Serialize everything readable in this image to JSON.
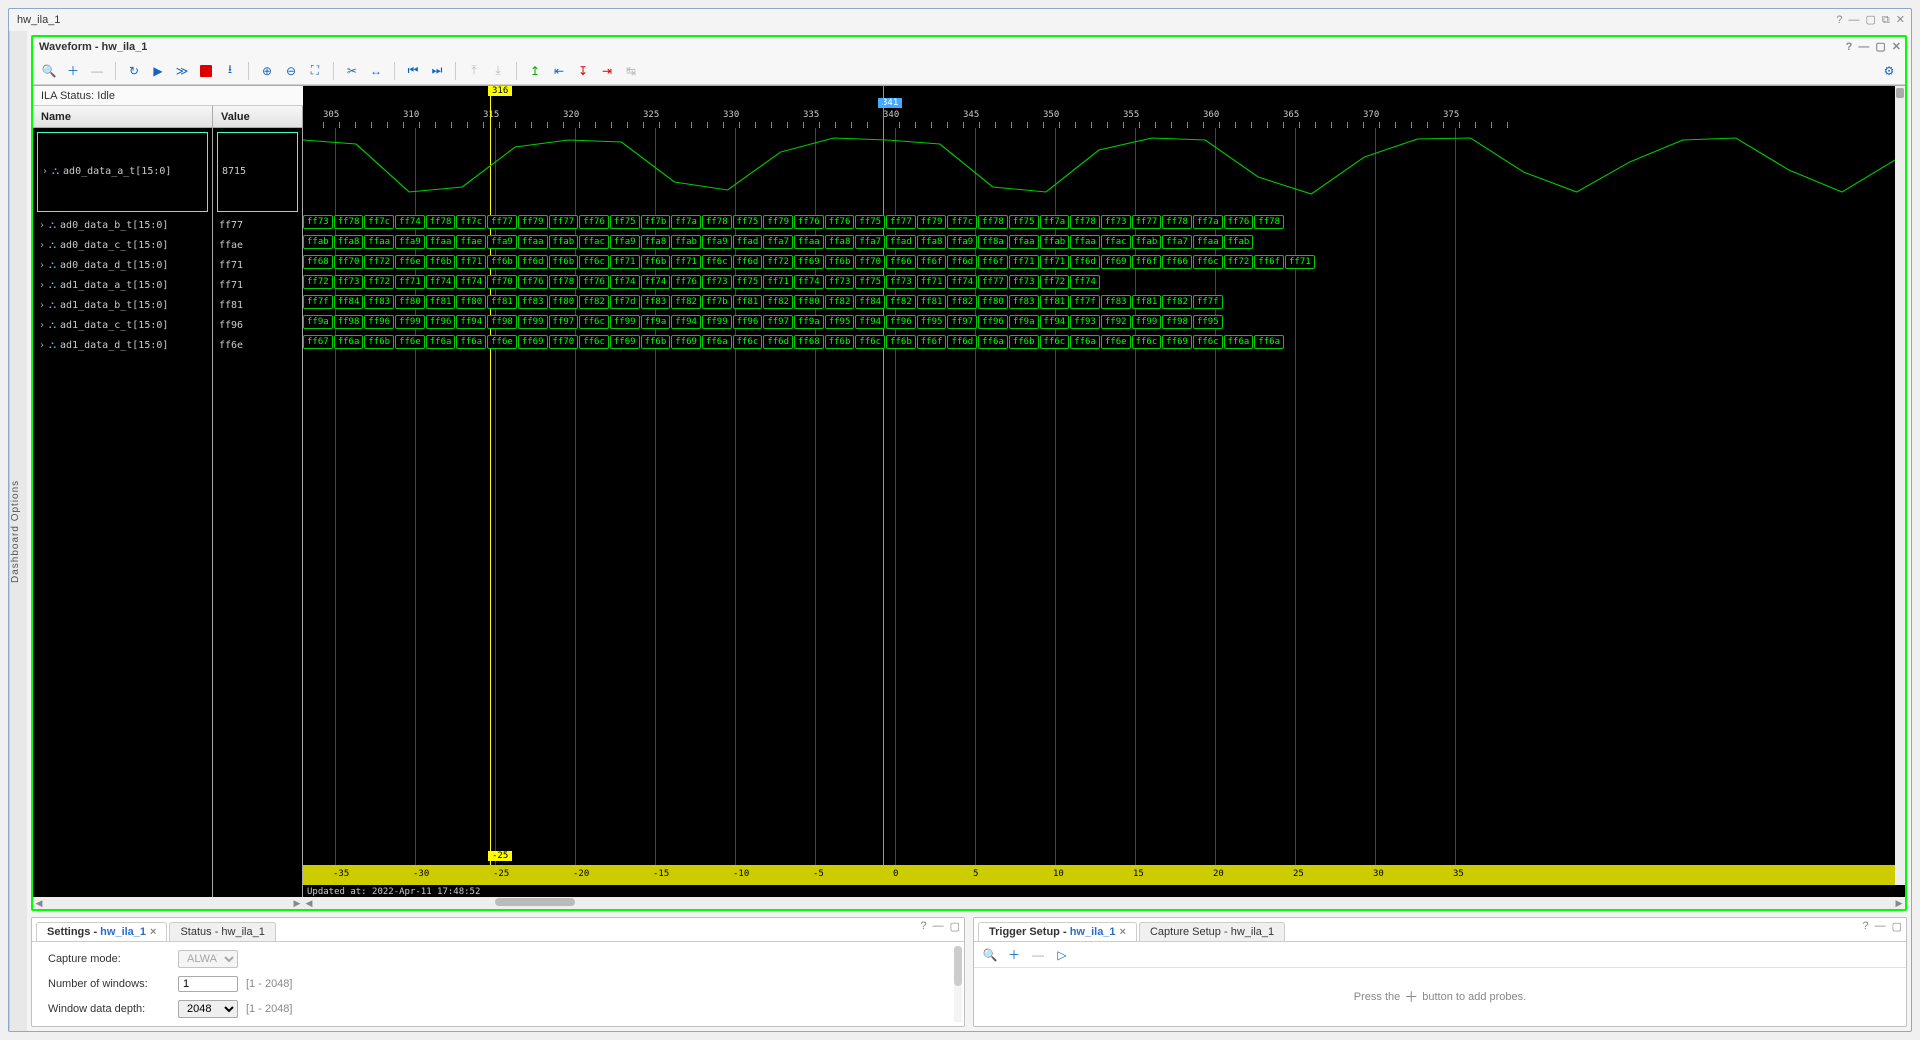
{
  "window": {
    "title": "hw_ila_1"
  },
  "dashboard_options_label": "Dashboard Options",
  "waveform": {
    "title": "Waveform - hw_ila_1",
    "status": "ILA Status:  Idle",
    "name_header": "Name",
    "value_header": "Value",
    "marker_top1": "316",
    "marker_top2": "341",
    "marker_bot": "-25",
    "update_text": "Updated at: 2022-Apr-11 17:48:52",
    "signals": [
      {
        "name": "ad0_data_a_t[15:0]",
        "value": "8715",
        "first": true
      },
      {
        "name": "ad0_data_b_t[15:0]",
        "value": "ff77"
      },
      {
        "name": "ad0_data_c_t[15:0]",
        "value": "ffae"
      },
      {
        "name": "ad0_data_d_t[15:0]",
        "value": "ff71"
      },
      {
        "name": "ad1_data_a_t[15:0]",
        "value": "ff71"
      },
      {
        "name": "ad1_data_b_t[15:0]",
        "value": "ff81"
      },
      {
        "name": "ad1_data_c_t[15:0]",
        "value": "ff96"
      },
      {
        "name": "ad1_data_d_t[15:0]",
        "value": "ff6e"
      }
    ],
    "top_ticks": [
      "305",
      "310",
      "315",
      "320",
      "325",
      "330",
      "335",
      "340",
      "345",
      "350",
      "355",
      "360",
      "365",
      "370",
      "375"
    ],
    "bot_ticks": [
      "-35",
      "-30",
      "-25",
      "-20",
      "-15",
      "-10",
      "-5",
      "0",
      "5",
      "10",
      "15",
      "20",
      "25",
      "30",
      "35"
    ],
    "bus_rows": [
      [
        "ff73",
        "ff78",
        "ff7c",
        "ff74",
        "ff78",
        "ff7c",
        "ff77",
        "ff79",
        "ff77",
        "ff76",
        "ff75",
        "ff7b",
        "ff7a",
        "ff78",
        "ff75",
        "ff79",
        "ff76",
        "ff76",
        "ff75",
        "ff77",
        "ff79",
        "ff7c",
        "ff78",
        "ff75",
        "ff7a",
        "ff78",
        "ff73",
        "ff77",
        "ff78",
        "ff7a",
        "ff76",
        "ff78"
      ],
      [
        "ffab",
        "ffa8",
        "ffaa",
        "ffa9",
        "ffaa",
        "ffae",
        "ffa9",
        "ffaa",
        "ffab",
        "ffac",
        "ffa9",
        "ffa8",
        "ffab",
        "ffa9",
        "ffad",
        "ffa7",
        "ffaa",
        "ffa8",
        "ffa7",
        "ffad",
        "ffa8",
        "ffa9",
        "ff8a",
        "ffaa",
        "ffab",
        "ffaa",
        "ffac",
        "ffab",
        "ffa7",
        "ffaa",
        "ffab"
      ],
      [
        "ff68",
        "ff70",
        "ff72",
        "ff6e",
        "ff6b",
        "ff71",
        "ff6b",
        "ff6d",
        "ff6b",
        "ff6c",
        "ff71",
        "ff6b",
        "ff71",
        "ff6c",
        "ff6d",
        "ff72",
        "ff69",
        "ff6b",
        "ff70",
        "ff66",
        "ff6f",
        "ff6d",
        "ff6f",
        "ff71",
        "ff71",
        "ff6d",
        "ff69",
        "ff6f",
        "ff66",
        "ff6c",
        "ff72",
        "ff6f",
        "ff71"
      ],
      [
        "ff72",
        "ff73",
        "ff72",
        "ff71",
        "ff74",
        "ff74",
        "ff70",
        "ff76",
        "ff78",
        "ff76",
        "ff74",
        "ff74",
        "ff76",
        "ff73",
        "ff75",
        "ff71",
        "ff74",
        "ff73",
        "ff75",
        "ff73",
        "ff71",
        "ff74",
        "ff77",
        "ff73",
        "ff72",
        "ff74"
      ],
      [
        "ff7f",
        "ff84",
        "ff83",
        "ff80",
        "ff81",
        "ff80",
        "ff81",
        "ff83",
        "ff80",
        "ff82",
        "ff7d",
        "ff83",
        "ff82",
        "ff7b",
        "ff81",
        "ff82",
        "ff80",
        "ff82",
        "ff84",
        "ff82",
        "ff81",
        "ff82",
        "ff80",
        "ff83",
        "ff81",
        "ff7f",
        "ff83",
        "ff81",
        "ff82",
        "ff7f"
      ],
      [
        "ff9a",
        "ff98",
        "ff96",
        "ff99",
        "ff96",
        "ff94",
        "ff98",
        "ff99",
        "ff97",
        "ff6c",
        "ff99",
        "ff9a",
        "ff94",
        "ff99",
        "ff96",
        "ff97",
        "ff9a",
        "ff95",
        "ff94",
        "ff96",
        "ff95",
        "ff97",
        "ff96",
        "ff9a",
        "ff94",
        "ff93",
        "ff92",
        "ff99",
        "ff98",
        "ff95"
      ],
      [
        "ff67",
        "ff6a",
        "ff6b",
        "ff6e",
        "ff6a",
        "ff6a",
        "ff6e",
        "ff69",
        "ff70",
        "ff6c",
        "ff69",
        "ff6b",
        "ff69",
        "ff6a",
        "ff6c",
        "ff6d",
        "ff68",
        "ff6b",
        "ff6c",
        "ff6b",
        "ff6f",
        "ff6d",
        "ff6a",
        "ff6b",
        "ff6c",
        "ff6a",
        "ff6e",
        "ff6c",
        "ff69",
        "ff6c",
        "ff6a",
        "ff6a"
      ]
    ]
  },
  "settings": {
    "tab1": "Settings - ",
    "tab1_link": "hw_ila_1",
    "tab2": "Status - hw_ila_1",
    "capture_mode_label": "Capture mode:",
    "capture_mode_value": "ALWAYS",
    "num_windows_label": "Number of windows:",
    "num_windows_value": "1",
    "num_windows_hint": "[1 - 2048]",
    "depth_label": "Window data depth:",
    "depth_value": "2048",
    "depth_hint": "[1 - 2048]"
  },
  "trigger": {
    "tab1": "Trigger Setup - ",
    "tab1_link": "hw_ila_1",
    "tab2": "Capture Setup - hw_ila_1",
    "empty_pre": "Press the ",
    "empty_post": " button to add probes."
  }
}
